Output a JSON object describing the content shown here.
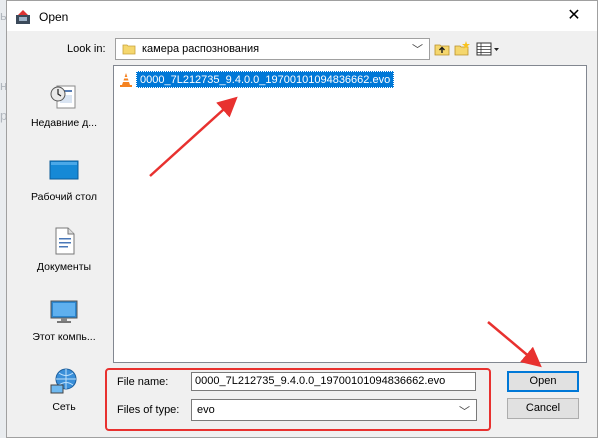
{
  "window": {
    "title": "Open",
    "close_glyph": "✕"
  },
  "lookin": {
    "label": "Look in:",
    "value": "камера распознования"
  },
  "toolbar": {
    "buttons": [
      "up-folder-icon",
      "new-folder-icon",
      "view-menu-icon"
    ]
  },
  "places": [
    {
      "label": "Недавние д...",
      "icon": "recent-places-icon"
    },
    {
      "label": "Рабочий стол",
      "icon": "desktop-icon"
    },
    {
      "label": "Документы",
      "icon": "documents-icon"
    },
    {
      "label": "Этот компь...",
      "icon": "this-pc-icon"
    },
    {
      "label": "Сеть",
      "icon": "network-icon"
    }
  ],
  "files": [
    {
      "name": "0000_7L212735_9.4.0.0_19700101094836662.evo",
      "icon": "vlc-file-icon",
      "selected": true
    }
  ],
  "filename": {
    "label": "File name:",
    "value": "0000_7L212735_9.4.0.0_19700101094836662.evo"
  },
  "filetype": {
    "label": "Files of type:",
    "value": "evo"
  },
  "buttons": {
    "open": "Open",
    "cancel": "Cancel"
  },
  "colors": {
    "accent": "#0078d7",
    "annotation": "#e8312f",
    "dialog_bg": "#f0f0f0"
  }
}
